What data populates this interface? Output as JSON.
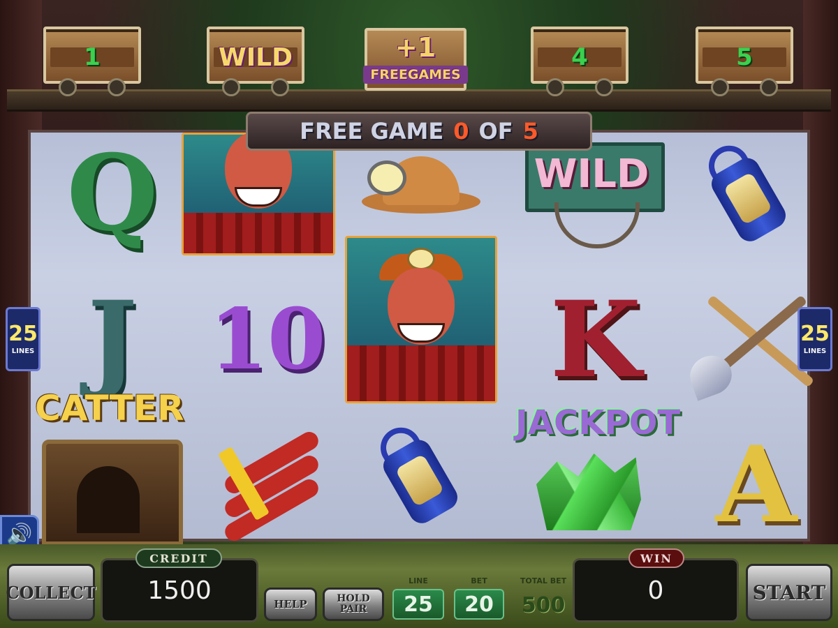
{
  "carts": [
    {
      "label": "1"
    },
    {
      "label": "WILD"
    },
    {
      "plus": "+1",
      "sub": "FREEGAMES"
    },
    {
      "label": "4"
    },
    {
      "label": "5"
    }
  ],
  "banner": {
    "prefix": "FREE GAME",
    "current": "0",
    "of": "OF",
    "total": "5"
  },
  "symbols": {
    "q": "Q",
    "j": "J",
    "ten": "10",
    "k": "K",
    "a": "A",
    "wild": "WILD",
    "scatter": "CATTER",
    "jackpot": "JACKPOT"
  },
  "lines_badge": {
    "value": "25",
    "label": "LINES"
  },
  "bottom": {
    "collect": "COLLECT",
    "credit_label": "CREDIT",
    "credit_value": "1500",
    "help": "HELP",
    "hold_pair": "HOLD PAIR",
    "line_label": "LINE",
    "line_value": "25",
    "bet_label": "BET",
    "bet_value": "20",
    "total_bet_label": "TOTAL BET",
    "total_bet_value": "500",
    "win_label": "WIN",
    "win_value": "0",
    "start": "START"
  },
  "icons": {
    "speaker": "speaker-icon"
  }
}
